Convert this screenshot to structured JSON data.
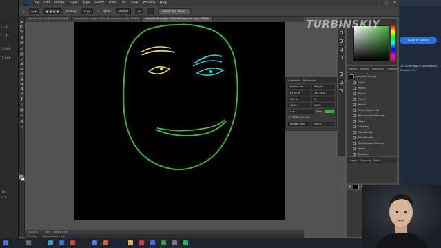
{
  "left_strip": {
    "items": [
      "1:1",
      "1:1",
      "Cont",
      "Cont",
      "Im",
      "Ch"
    ]
  },
  "menubar": {
    "logo": "Ps",
    "items": [
      "File",
      "Edit",
      "Image",
      "Layer",
      "Type",
      "Select",
      "Filter",
      "3D",
      "View",
      "Window",
      "Help"
    ],
    "window_controls": [
      "–",
      "□",
      "✕"
    ]
  },
  "options_bar": {
    "feather_label": "Feather:",
    "feather_value": "0 px",
    "style_label": "Style:",
    "style_value": "Normal",
    "select_mask_label": "Select and Mask..."
  },
  "tabs": [
    {
      "label": "sexyass 05.png @ 100% (RGB/8)",
      "active": false
    },
    {
      "label": "sexyass 05.png @ 74.8% (Background copy, RGB/8)",
      "active": false
    },
    {
      "label": "sexyass 06.png @ 100% (Background copy, RGB/8)",
      "active": true
    }
  ],
  "status_bar": {
    "zoom": "100.57%",
    "doc": "Doc: 1,00M/1,00M"
  },
  "timeline": {
    "items": [
      "Timeline",
      "Measurement Log"
    ]
  },
  "watermark": "TURBINSKIY",
  "character_panel": {
    "tabs": [
      "Character",
      "Paragraph"
    ],
    "font_family": "Bookba-ma",
    "font_style": "Regular",
    "font_size": "67.96 pt",
    "leading": "185.31 pt",
    "kerning": "Metrics",
    "tracking": "0",
    "vscale": "100%",
    "hscale": "100%",
    "baseline": "0 pt",
    "color_label": "Color:",
    "language": "English: USA",
    "antialias": "Sharp"
  },
  "history_panel": {
    "tabs": [
      "History",
      "Actions",
      "Adjustme",
      "Libraries"
    ],
    "snapshot": "sexyass 05.png",
    "items": [
      "Open",
      "Pencil",
      "Pencil",
      "Pencil",
      "Pencil",
      "Pencil (Same As)",
      "Rectangular Marquee",
      "Move",
      "Deselect",
      "Paint Bucket",
      "Paint Bucket",
      "Rectangular Marquee",
      "Move",
      "Deselect"
    ]
  },
  "layers_panel": {
    "tabs": [
      "Layers",
      "Channels",
      "Paths"
    ],
    "layer_name": "Background"
  },
  "browser": {
    "send_button": "Send to extras",
    "text": "11, ControlNet 0 ControlNet 0 Weight: 1.0,"
  },
  "colors": {
    "stroke_green": "#3fb23b",
    "stroke_yellow": "#e8e04a",
    "stroke_teal": "#38c8d8",
    "stroke_mouth": "#46b83a"
  }
}
